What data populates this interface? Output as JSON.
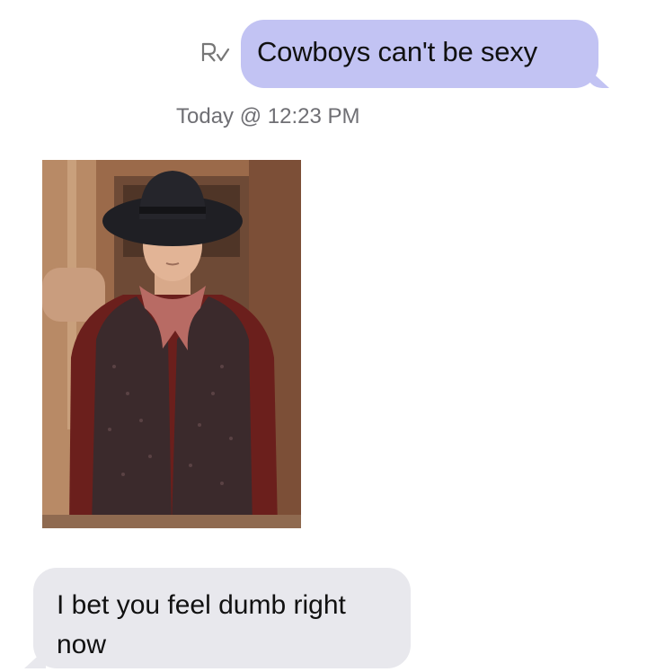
{
  "thread": {
    "outgoing_message": "Cowboys can't be sexy",
    "timestamp": "Today @ 12:23 PM",
    "incoming_message": "I bet you feel dumb right now"
  },
  "icons": {
    "read_receipt": "read-receipt-icon"
  },
  "colors": {
    "outgoing_bubble": "#c2c3f3",
    "incoming_bubble": "#e8e8ed",
    "timestamp_text": "#6f6f74",
    "background": "#ffffff"
  }
}
